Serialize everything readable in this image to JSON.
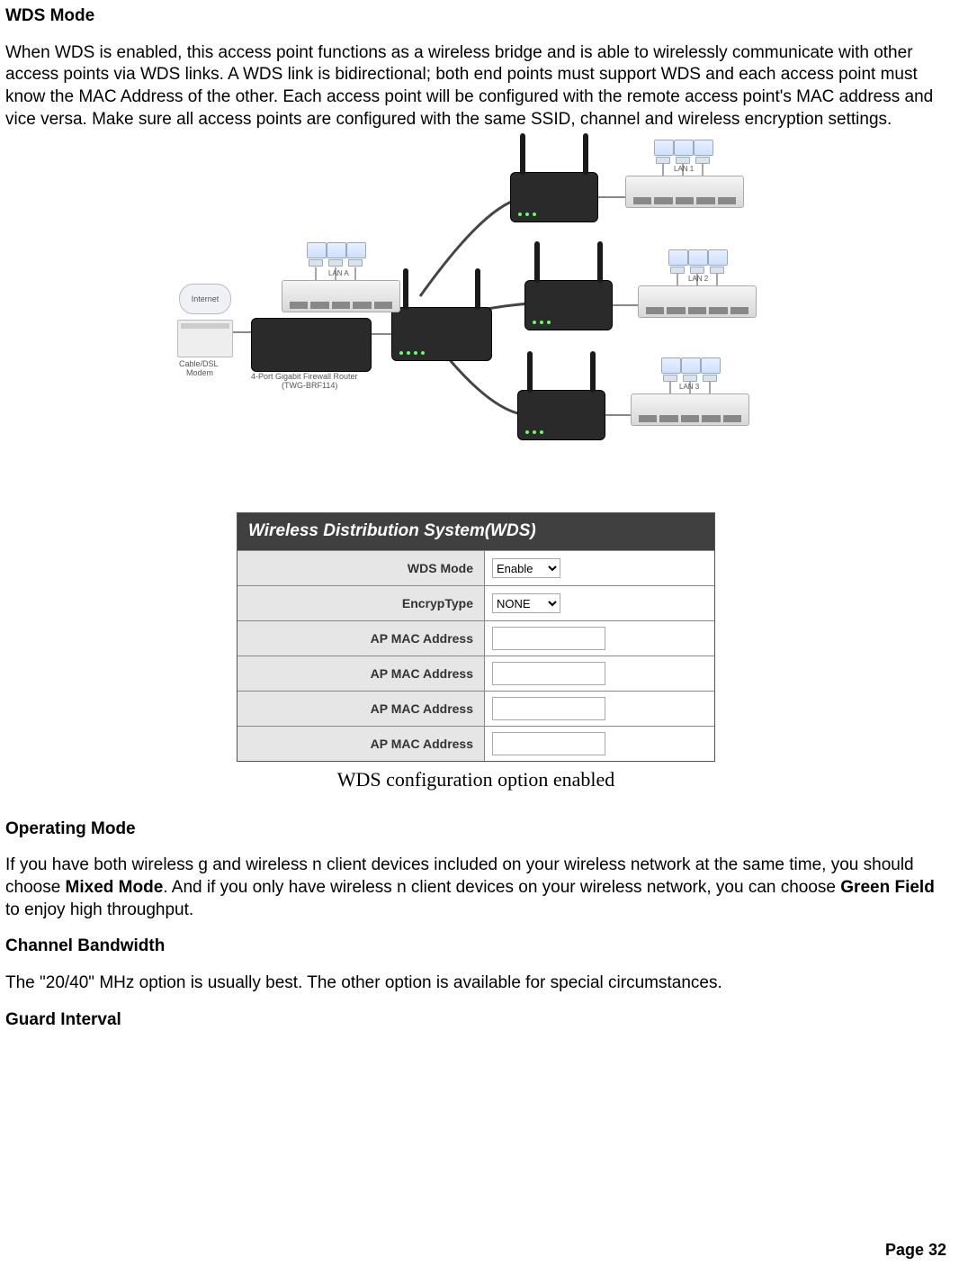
{
  "h1": "WDS Mode",
  "p1": "When WDS is enabled, this access point functions as a wireless bridge and is able to wirelessly communicate with other access points via WDS links. A WDS link is bidirectional; both end points must support WDS and each access point must know the MAC Address of the other. Each access point will be configured with the remote access point's MAC address and vice versa. Make sure all access points are configured with the same SSID, channel and wireless encryption settings.",
  "diagram": {
    "lanA": "LAN A",
    "lan1": "LAN 1",
    "lan2": "LAN 2",
    "lan3": "LAN 3",
    "internet": "Internet",
    "cable": "Cable/DSL",
    "modem": "Modem",
    "router1": "4-Port Gigabit Firewall Router",
    "router2": "(TWG-BRF114)"
  },
  "form": {
    "title": "Wireless Distribution System(WDS)",
    "rows": [
      {
        "label": "WDS Mode",
        "type": "select",
        "value": "Enable"
      },
      {
        "label": "EncrypType",
        "type": "select",
        "value": "NONE"
      },
      {
        "label": "AP MAC Address",
        "type": "text",
        "value": ""
      },
      {
        "label": "AP MAC Address",
        "type": "text",
        "value": ""
      },
      {
        "label": "AP MAC Address",
        "type": "text",
        "value": ""
      },
      {
        "label": "AP MAC Address",
        "type": "text",
        "value": ""
      }
    ]
  },
  "caption": "WDS configuration option enabled",
  "h2": "Operating Mode",
  "p2a": "If you have both wireless g and wireless n client devices included on your wireless network at the same time, you should choose ",
  "p2b": "Mixed Mode",
  "p2c": ". And if you only have wireless n client devices on your wireless network, you can choose ",
  "p2d": "Green Field",
  "p2e": " to enjoy high throughput.",
  "h3": "Channel Bandwidth",
  "p3": "The \"20/40\" MHz option is usually best. The other option is available for special circumstances.",
  "h4": "Guard Interval",
  "footer": "Page  32"
}
